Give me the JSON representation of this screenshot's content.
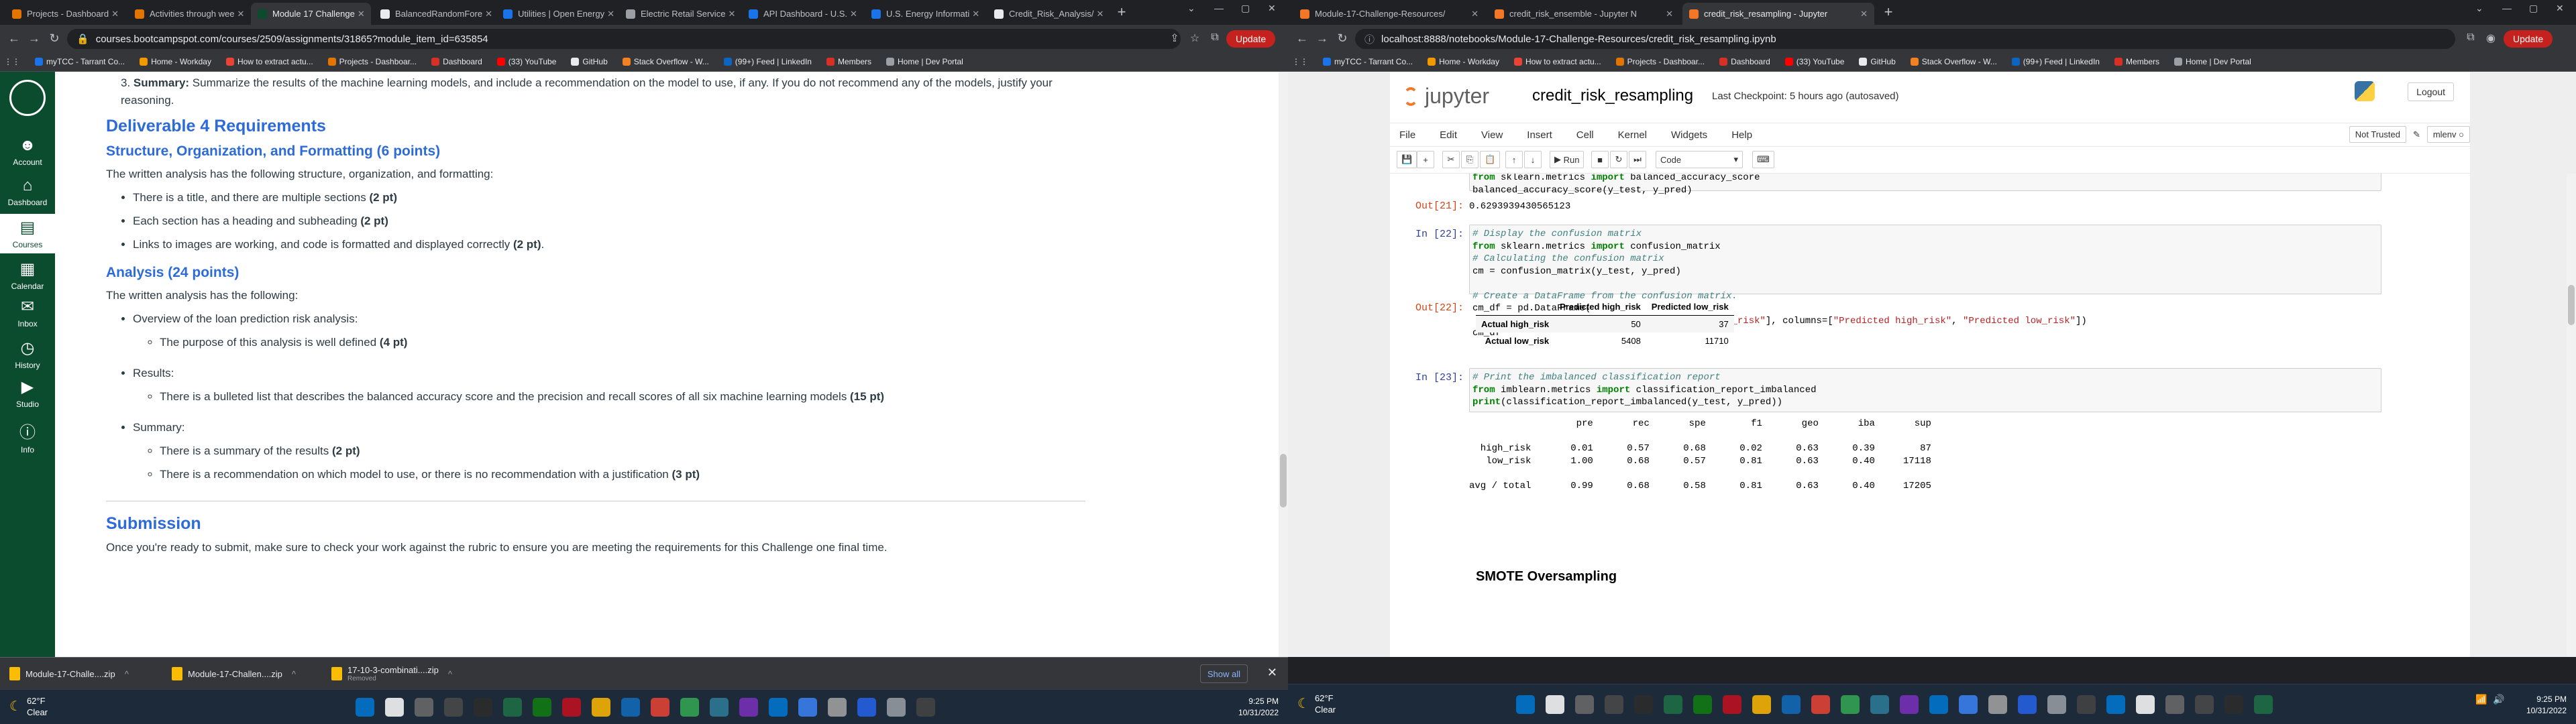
{
  "left": {
    "tabs": [
      {
        "label": "Projects - Dashboard",
        "color": "#e37400"
      },
      {
        "label": "Activities through wee",
        "color": "#e37400"
      },
      {
        "label": "Module 17 Challenge",
        "color": "#0b4b2e",
        "active": true
      },
      {
        "label": "BalancedRandomFore",
        "color": "#e8eaed"
      },
      {
        "label": "Utilities | Open Energy",
        "color": "#1a73e8"
      },
      {
        "label": "Electric Retail Service",
        "color": "#9aa0a6"
      },
      {
        "label": "API Dashboard - U.S.",
        "color": "#1a73e8"
      },
      {
        "label": "U.S. Energy Informati",
        "color": "#1a73e8"
      },
      {
        "label": "Credit_Risk_Analysis/",
        "color": "#e8eaed"
      }
    ],
    "url": "courses.bootcampspot.com/courses/2509/assignments/31865?module_item_id=635854",
    "update": "Update",
    "bookmarks": [
      {
        "label": "myTCC - Tarrant Co...",
        "color": "#1a73e8"
      },
      {
        "label": "Home - Workday",
        "color": "#f29900"
      },
      {
        "label": "How to extract actu...",
        "color": "#ea4335"
      },
      {
        "label": "Projects - Dashboar...",
        "color": "#e37400"
      },
      {
        "label": "Dashboard",
        "color": "#d93025"
      },
      {
        "label": "(33) YouTube",
        "color": "#ff0000"
      },
      {
        "label": "GitHub",
        "color": "#e8eaed"
      },
      {
        "label": "Stack Overflow - W...",
        "color": "#f48024"
      },
      {
        "label": "(99+) Feed | LinkedIn",
        "color": "#0a66c2"
      },
      {
        "label": "Members",
        "color": "#d93025"
      },
      {
        "label": "Home | Dev Portal",
        "color": "#9aa0a6"
      }
    ],
    "canvas_nav": [
      {
        "label": "Account",
        "icon": "☻"
      },
      {
        "label": "Dashboard",
        "icon": "⌂"
      },
      {
        "label": "Courses",
        "icon": "▤",
        "selected": true
      },
      {
        "label": "Calendar",
        "icon": "▦"
      },
      {
        "label": "Inbox",
        "icon": "✉"
      },
      {
        "label": "History",
        "icon": "◷"
      },
      {
        "label": "Studio",
        "icon": "▶"
      },
      {
        "label": "Info",
        "icon": "ⓘ"
      }
    ],
    "doc": {
      "summary_num": "3.",
      "summary_label": "Summary:",
      "summary_text": "Summarize the results of the machine learning models, and include a recommendation on the model to use, if any. If you do not recommend any of the models, justify your reasoning.",
      "deliverable_title": "Deliverable 4 Requirements",
      "structure_title": "Structure, Organization, and Formatting (6 points)",
      "structure_intro": "The written analysis has the following structure, organization, and formatting:",
      "structure_items": [
        {
          "text": "There is a title, and there are multiple sections ",
          "pts": "(2 pt)"
        },
        {
          "text": "Each section has a heading and subheading ",
          "pts": "(2 pt)"
        },
        {
          "text": "Links to images are working, and code is formatted and displayed correctly ",
          "pts": "(2 pt)",
          "suffix": "."
        }
      ],
      "analysis_title": "Analysis (24 points)",
      "analysis_intro": "The written analysis has the following:",
      "overview_label": "Overview of the loan prediction risk analysis:",
      "overview_sub": {
        "text": "The purpose of this analysis is well defined ",
        "pts": "(4 pt)"
      },
      "results_label": "Results:",
      "results_sub": {
        "text": "There is a bulleted list that describes the balanced accuracy score and the precision and recall scores of all six machine learning models ",
        "pts": "(15 pt)"
      },
      "summary2_label": "Summary:",
      "summary2_subs": [
        {
          "text": "There is a summary of the results ",
          "pts": "(2 pt)"
        },
        {
          "text": "There is a recommendation on which model to use, or there is no recommendation with a justification ",
          "pts": "(3 pt)"
        }
      ],
      "submission_title": "Submission",
      "submission_text": "Once you're ready to submit, make sure to check your work against the rubric to ensure you are meeting the requirements for this Challenge one final time."
    },
    "downloads": [
      {
        "name": "Module-17-Challe....zip",
        "sub": ""
      },
      {
        "name": "Module-17-Challen....zip",
        "sub": ""
      },
      {
        "name": "17-10-3-combinati....zip",
        "sub": "Removed"
      }
    ],
    "show_all": "Show all",
    "weather": {
      "temp": "62°F",
      "cond": "Clear"
    },
    "clock": {
      "time": "9:25 PM",
      "date": "10/31/2022"
    }
  },
  "right": {
    "tabs": [
      {
        "label": "Module-17-Challenge-Resources/",
        "color": "#f37726"
      },
      {
        "label": "credit_risk_ensemble - Jupyter N",
        "color": "#f37726"
      },
      {
        "label": "credit_risk_resampling - Jupyter",
        "color": "#f37726",
        "active": true
      }
    ],
    "url": "localhost:8888/notebooks/Module-17-Challenge-Resources/credit_risk_resampling.ipynb",
    "update": "Update",
    "bookmarks": [
      {
        "label": "myTCC - Tarrant Co...",
        "color": "#1a73e8"
      },
      {
        "label": "Home - Workday",
        "color": "#f29900"
      },
      {
        "label": "How to extract actu...",
        "color": "#ea4335"
      },
      {
        "label": "Projects - Dashboar...",
        "color": "#e37400"
      },
      {
        "label": "Dashboard",
        "color": "#d93025"
      },
      {
        "label": "(33) YouTube",
        "color": "#ff0000"
      },
      {
        "label": "GitHub",
        "color": "#e8eaed"
      },
      {
        "label": "Stack Overflow - W...",
        "color": "#f48024"
      },
      {
        "label": "(99+) Feed | LinkedIn",
        "color": "#0a66c2"
      },
      {
        "label": "Members",
        "color": "#d93025"
      },
      {
        "label": "Home | Dev Portal",
        "color": "#9aa0a6"
      }
    ],
    "jupyter": {
      "logo_text": "jupyter",
      "notebook_name": "credit_risk_resampling",
      "checkpoint": "Last Checkpoint: 5 hours ago  (autosaved)",
      "logout": "Logout",
      "menu": [
        "File",
        "Edit",
        "View",
        "Insert",
        "Cell",
        "Kernel",
        "Widgets",
        "Help"
      ],
      "trusted": "Not Trusted",
      "kernel": "mlenv",
      "run_label": "Run",
      "cell_type": "Code"
    },
    "cells": {
      "c21_code_line1_kw": "from",
      "c21_code_line1_rest": " sklearn.metrics ",
      "c21_code_line1_kw2": "import",
      "c21_code_line1_end": " balanced_accuracy_score",
      "c21_code_line2": "balanced_accuracy_score(y_test, y_pred)",
      "out21_prompt": "Out[21]:",
      "out21_value": "0.6293939430565123",
      "in22_prompt": "In [22]:",
      "c22_l1": "# Display the confusion matrix",
      "c22_l2_rest": " sklearn.metrics ",
      "c22_l2_end": " confusion_matrix",
      "c22_l3": "# Calculating the confusion matrix",
      "c22_l4": "cm = confusion_matrix(y_test, y_pred)",
      "c22_l6": "# Create a DataFrame from the confusion matrix.",
      "c22_l7": "cm_df = pd.DataFrame(",
      "c22_l8a": "    cm, index=[",
      "c22_l8s1": "\"Actual high_risk\"",
      "c22_l8s2": "\"Actual low_risk\"",
      "c22_l8b": "], columns=[",
      "c22_l8s3": "\"Predicted high_risk\"",
      "c22_l8s4": "\"Predicted low_risk\"",
      "c22_l8c": "])",
      "c22_l9": "cm_df",
      "out22_prompt": "Out[22]:",
      "df_cols": [
        "Predicted high_risk",
        "Predicted low_risk"
      ],
      "df_rows": [
        {
          "label": "Actual high_risk",
          "vals": [
            "50",
            "37"
          ]
        },
        {
          "label": "Actual low_risk",
          "vals": [
            "5408",
            "11710"
          ]
        }
      ],
      "in23_prompt": "In [23]:",
      "c23_l1": "# Print the imbalanced classification report",
      "c23_l2_rest": " imblearn.metrics ",
      "c23_l2_end": " classification_report_imbalanced",
      "c23_l3_kw": "print",
      "c23_l3_rest": "(classification_report_imbalanced(y_test, y_pred))",
      "report": "                   pre       rec       spe        f1       geo       iba       sup\n\n  high_risk       0.01      0.57      0.68      0.02      0.63      0.39        87\n   low_risk       1.00      0.68      0.57      0.81      0.63      0.40     17118\n\navg / total       0.99      0.68      0.58      0.81      0.63      0.40     17205",
      "smote_title": "SMOTE Oversampling"
    },
    "weather": {
      "temp": "62°F",
      "cond": "Clear"
    },
    "clock": {
      "time": "9:25 PM",
      "date": "10/31/2022"
    }
  }
}
